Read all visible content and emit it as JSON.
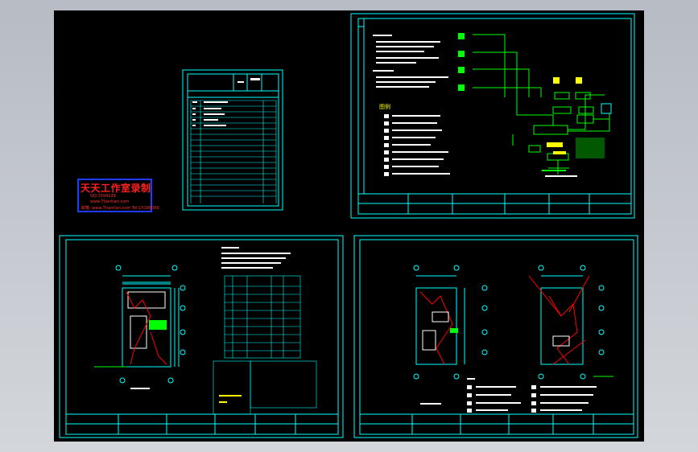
{
  "stamp": {
    "title": "天天工作室录制",
    "line2": "QQ:1594229",
    "line3": "www.7tiantian.com",
    "line4": "邮箱: www.7tiantian.com Tel:15198069"
  },
  "colors": {
    "background": "#000000",
    "frame": "#00ffff",
    "text": "#ffffff",
    "wire": "#00ff00",
    "highlight": "#ffff00",
    "annotation": "#ff0000"
  }
}
